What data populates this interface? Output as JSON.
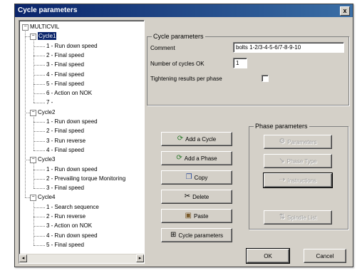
{
  "window": {
    "title": "Cycle parameters",
    "close_label": "x"
  },
  "tree": {
    "root": "MULTICVIL",
    "cycles": [
      {
        "label": "Cycle1",
        "items": [
          "1 - Run down speed",
          "2 - Final speed",
          "3 - Final speed",
          "4 - Final speed",
          "5 - Final speed",
          "6 - Action on NOK",
          "7 -"
        ]
      },
      {
        "label": "Cycle2",
        "items": [
          "1 - Run down speed",
          "2 - Final speed",
          "3 - Run reverse",
          "4 - Final speed"
        ]
      },
      {
        "label": "Cycle3",
        "items": [
          "1 - Run down speed",
          "2 - Prevailing torque Monitoring",
          "3 - Final speed"
        ]
      },
      {
        "label": "Cycle4",
        "items": [
          "1 - Search sequence",
          "2 - Run reverse",
          "3 - Action on NOK",
          "4 - Run down speed",
          "5 - Final speed"
        ]
      }
    ],
    "expander_minus": "−"
  },
  "cycle_params": {
    "legend": "Cycle parameters",
    "comment_label": "Comment",
    "comment_value": "bolts 1-2/3-4-5-6/7-8-9-10",
    "cycles_ok_label": "Number of cycles OK",
    "cycles_ok_value": "1",
    "tightening_label": "Tightening results per phase"
  },
  "actions": {
    "add_cycle": "Add a Cycle",
    "add_phase": "Add a Phase",
    "copy": "Copy",
    "delete": "Delete",
    "paste": "Paste",
    "cycle_parameters": "Cycle parameters"
  },
  "phase_params": {
    "legend": "Phase parameters",
    "parameters": "Parameters",
    "phase_type": "Phase Type",
    "instructions": "Instructions",
    "spindle_list": "Spindle List"
  },
  "footer": {
    "ok": "OK",
    "cancel": "Cancel"
  }
}
